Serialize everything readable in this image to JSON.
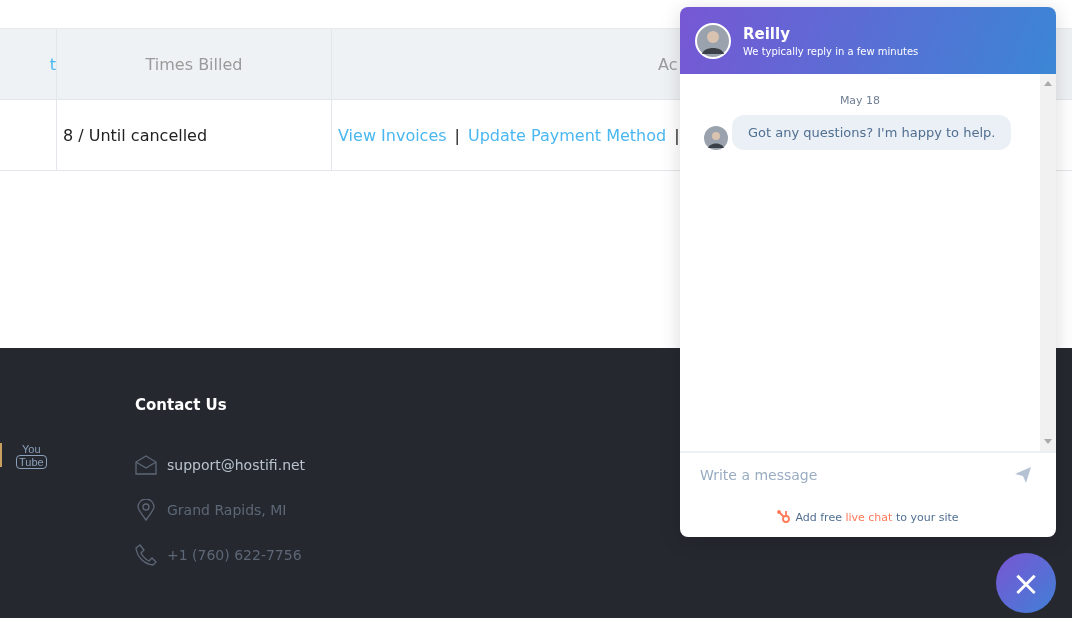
{
  "table": {
    "columns": [
      {
        "label": "t",
        "kind": "link"
      },
      {
        "label": "Times Billed",
        "kind": "plain"
      },
      {
        "label": "Ac",
        "kind": "plain"
      }
    ],
    "rows": [
      {
        "cells": [
          {
            "kind": "text",
            "text": ""
          },
          {
            "kind": "text",
            "text": "8 / Until cancelled"
          },
          {
            "kind": "links",
            "links": [
              "View Invoices",
              "Update Payment Method"
            ],
            "separator": "|"
          }
        ]
      }
    ]
  },
  "footer": {
    "contact_title": "Contact Us",
    "contacts": [
      {
        "kind": "email",
        "text": "support@hostifi.net"
      },
      {
        "kind": "location",
        "text": "Grand Rapids, MI"
      },
      {
        "kind": "phone",
        "text": "+1 (760) 622-7756"
      }
    ],
    "social_text": [
      "You",
      "Tube"
    ]
  },
  "chat": {
    "agent": "Reilly",
    "subtitle": "We typically reply in a few minutes",
    "date": "May 18",
    "messages": [
      {
        "text": "Got any questions? I'm happy to help."
      }
    ],
    "input": {
      "placeholder": "Write a message"
    },
    "promo": {
      "before": "Add free ",
      "link": "live chat",
      "after": " to your site"
    },
    "close_label": "×"
  }
}
